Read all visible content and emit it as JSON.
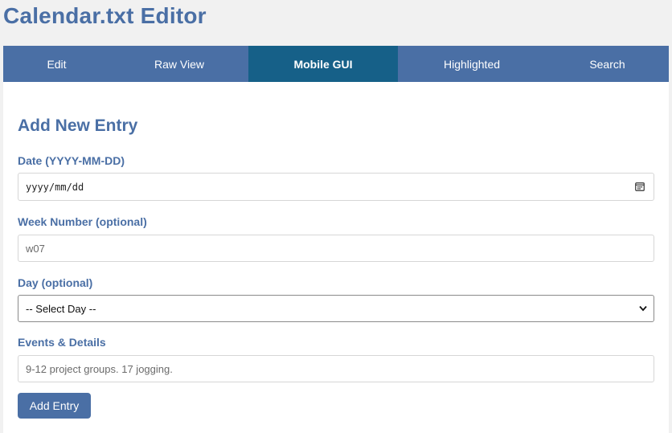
{
  "app": {
    "title": "Calendar.txt Editor"
  },
  "tabs": [
    {
      "label": "Edit"
    },
    {
      "label": "Raw View"
    },
    {
      "label": "Mobile GUI"
    },
    {
      "label": "Highlighted"
    },
    {
      "label": "Search"
    }
  ],
  "active_tab": "Mobile GUI",
  "form": {
    "title": "Add New Entry",
    "date": {
      "label": "Date (YYYY-MM-DD)",
      "placeholder": "yyyy/mm/dd",
      "icon": "calendar-icon"
    },
    "week": {
      "label": "Week Number (optional)",
      "placeholder": "w07"
    },
    "day": {
      "label": "Day (optional)",
      "selected": "-- Select Day --",
      "icon": "chevron-down-icon"
    },
    "events": {
      "label": "Events & Details",
      "placeholder": "9-12 project groups. 17 jogging."
    },
    "submit_label": "Add Entry"
  },
  "colors": {
    "brand": "#4a6fa5",
    "active_tab": "#166088",
    "page_bg": "#f1f1f1",
    "panel_bg": "#ffffff"
  }
}
